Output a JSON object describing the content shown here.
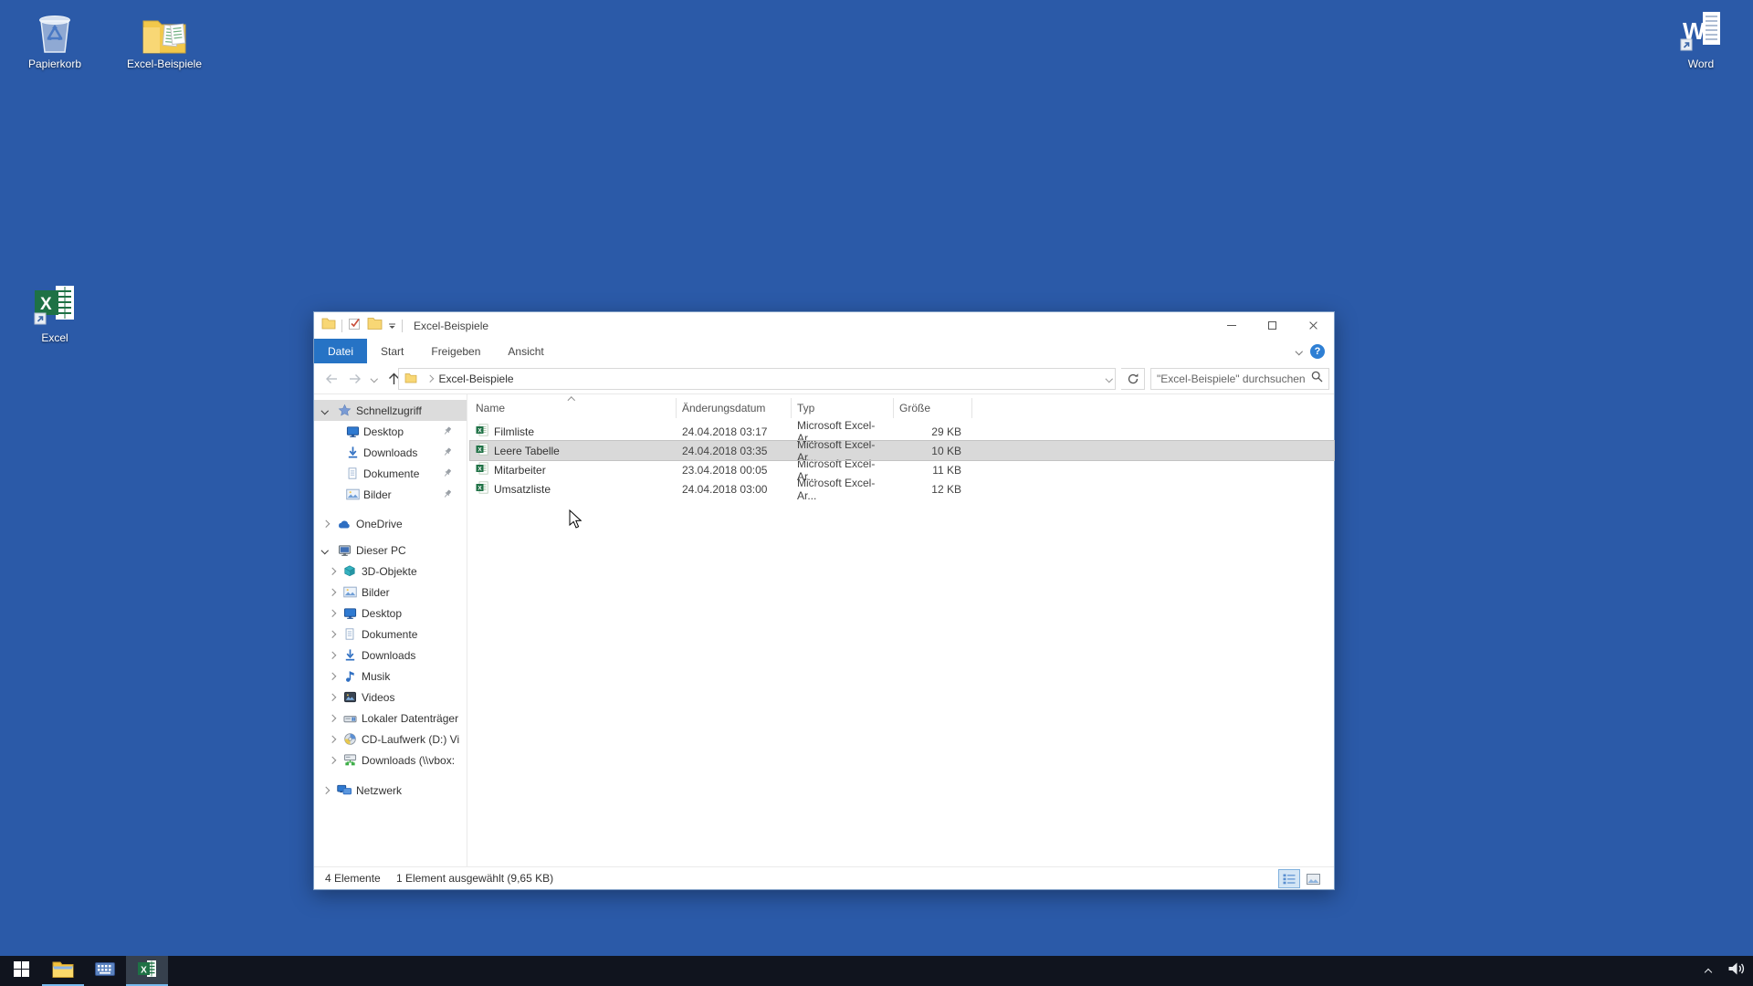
{
  "desktop": {
    "icons": [
      {
        "label": "Papierkorb"
      },
      {
        "label": "Excel-Beispiele"
      },
      {
        "label": "Word"
      },
      {
        "label": "Excel"
      }
    ]
  },
  "explorer": {
    "title": "Excel-Beispiele",
    "ribbon_tabs": [
      {
        "label": "Datei",
        "active": true
      },
      {
        "label": "Start",
        "active": false
      },
      {
        "label": "Freigeben",
        "active": false
      },
      {
        "label": "Ansicht",
        "active": false
      }
    ],
    "address_bar": {
      "path": "Excel-Beispiele",
      "search_placeholder": "\"Excel-Beispiele\" durchsuchen"
    },
    "navigation": [
      {
        "label": "Schnellzugriff",
        "selected": true,
        "expanded": true
      },
      {
        "label": "Desktop",
        "pinned": true
      },
      {
        "label": "Downloads",
        "pinned": true
      },
      {
        "label": "Dokumente",
        "pinned": true
      },
      {
        "label": "Bilder",
        "pinned": true
      },
      {
        "label": "OneDrive"
      },
      {
        "label": "Dieser PC",
        "expanded": true
      },
      {
        "label": "3D-Objekte"
      },
      {
        "label": "Bilder"
      },
      {
        "label": "Desktop"
      },
      {
        "label": "Dokumente"
      },
      {
        "label": "Downloads"
      },
      {
        "label": "Musik"
      },
      {
        "label": "Videos"
      },
      {
        "label": "Lokaler Datenträger"
      },
      {
        "label": "CD-Laufwerk (D:) Vi"
      },
      {
        "label": "Downloads (\\\\vbox:"
      },
      {
        "label": "Netzwerk"
      }
    ],
    "file_list": {
      "columns": [
        "Name",
        "Änderungsdatum",
        "Typ",
        "Größe"
      ],
      "sorted_by": "Name",
      "rows": [
        {
          "name": "Filmliste",
          "date": "24.04.2018 03:17",
          "type": "Microsoft Excel-Ar...",
          "size": "29 KB",
          "selected": false
        },
        {
          "name": "Leere Tabelle",
          "date": "24.04.2018 03:35",
          "type": "Microsoft Excel-Ar...",
          "size": "10 KB",
          "selected": true
        },
        {
          "name": "Mitarbeiter",
          "date": "23.04.2018 00:05",
          "type": "Microsoft Excel-Ar...",
          "size": "11 KB",
          "selected": false
        },
        {
          "name": "Umsatzliste",
          "date": "24.04.2018 03:00",
          "type": "Microsoft Excel-Ar...",
          "size": "12 KB",
          "selected": false
        }
      ]
    },
    "status_bar": {
      "count": "4 Elemente",
      "selection": "1 Element ausgewählt (9,65 KB)"
    }
  },
  "colors": {
    "desktop_background": "#2b5aa8",
    "taskbar_background": "#10141e",
    "active_tab_blue": "#2673c5",
    "excel_green": "#1e7145",
    "folder_yellow": "#f8d775",
    "selection_gray": "#d9d9d9"
  }
}
